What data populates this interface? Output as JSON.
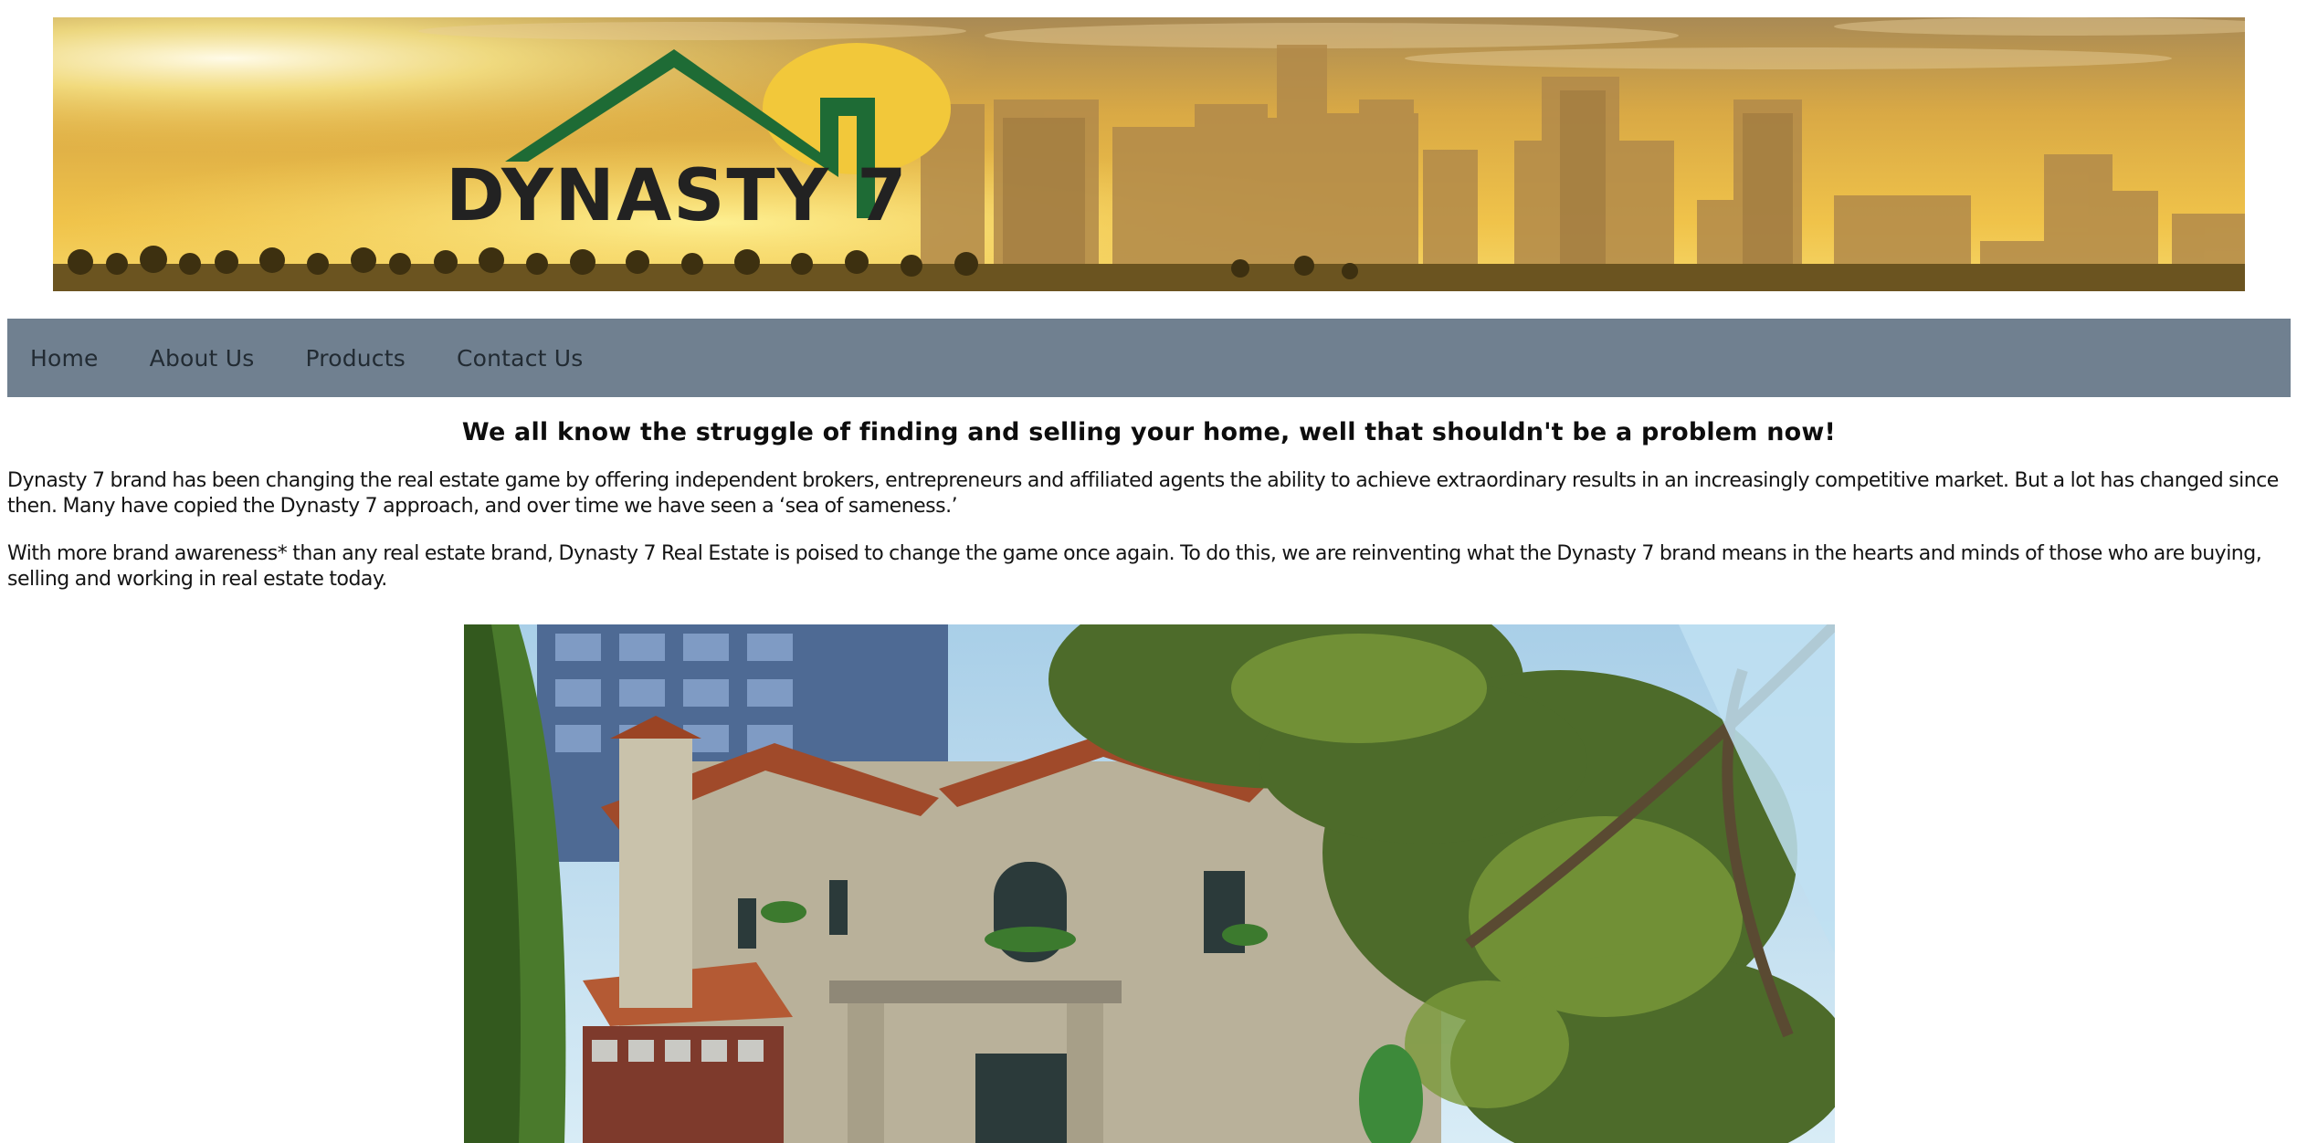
{
  "banner": {
    "logo_text": "DYNASTY 7",
    "logo_digit": "7",
    "colors": {
      "sky_top": "#c9953a",
      "sky_glow": "#f6e27a",
      "logo_green": "#1e6b35",
      "logo_dark": "#222222",
      "sun_disc": "#f2c83a"
    }
  },
  "nav": {
    "items": [
      {
        "label": "Home"
      },
      {
        "label": "About Us"
      },
      {
        "label": "Products"
      },
      {
        "label": "Contact Us"
      }
    ],
    "background": "#708090"
  },
  "main": {
    "headline": "We all know the struggle of finding and selling your home, well that shouldn't be a problem now!",
    "paragraph_1": "Dynasty 7 brand has been changing the real estate game by offering independent brokers, entrepreneurs and affiliated agents the ability to achieve extraordinary results in an increasingly competitive market. But a lot has changed since then. Many have copied the Dynasty 7 approach, and over time we have seen a ‘sea of sameness.’",
    "paragraph_2": "With more brand awareness* than any real estate brand, Dynasty 7 Real Estate is poised to change the game once again. To do this, we are reinventing what the Dynasty 7 brand means in the hearts and minds of those who are buying, selling and working in real estate today."
  },
  "house_image": {
    "icon": "house-photo"
  }
}
